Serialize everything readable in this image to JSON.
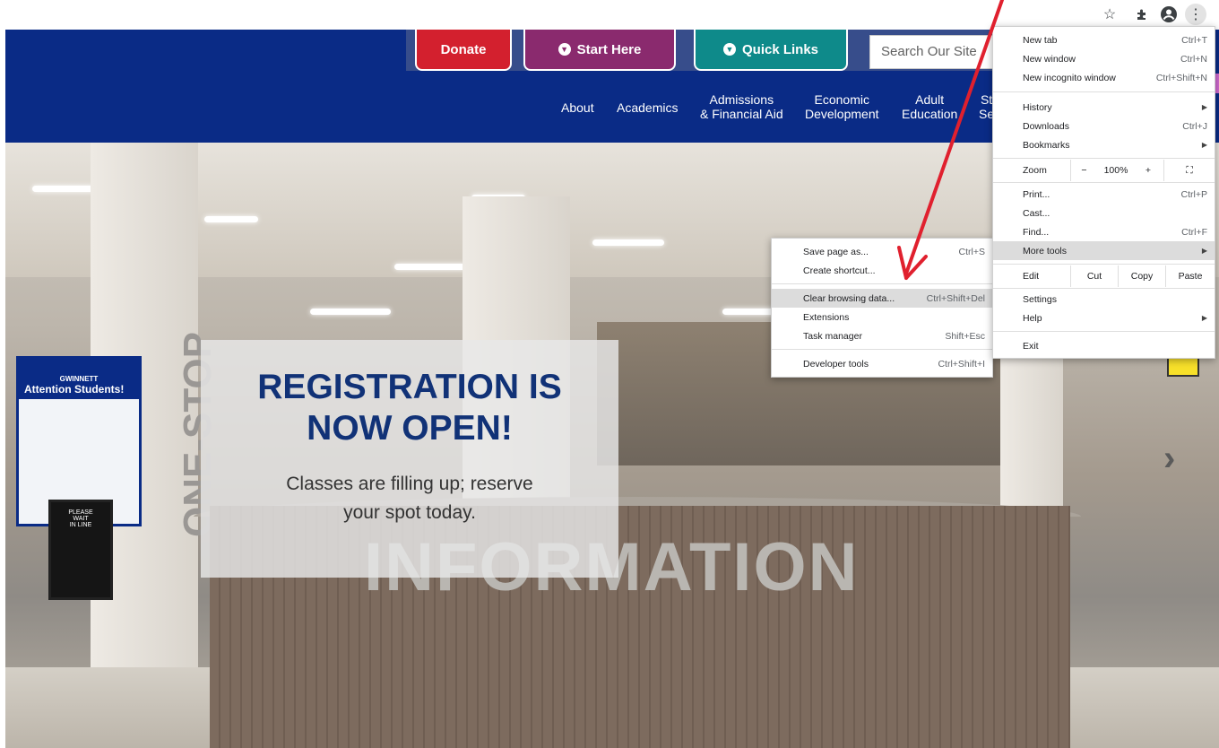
{
  "browser": {
    "menu_icon": "⋮"
  },
  "site": {
    "buttons": {
      "donate": "Donate",
      "start_here": "Start Here",
      "quick_links": "Quick Links"
    },
    "search": {
      "placeholder": "Search Our Site"
    },
    "nav": [
      {
        "line1": "About",
        "line2": ""
      },
      {
        "line1": "Academics",
        "line2": ""
      },
      {
        "line1": "Admissions",
        "line2": "& Financial Aid"
      },
      {
        "line1": "Economic",
        "line2": "Development"
      },
      {
        "line1": "Adult",
        "line2": "Education"
      },
      {
        "line1": "St",
        "line2": "Se"
      }
    ],
    "colors": {
      "header": "#0a2b86",
      "donate": "#d3202e",
      "start_here": "#8a2a6e",
      "quick_links": "#0e8a8a"
    }
  },
  "hero": {
    "title_line1": "REGISTRATION IS",
    "title_line2": "NOW OPEN!",
    "subtitle_line1": "Classes are filling up; reserve",
    "subtitle_line2": "your spot today.",
    "scene": {
      "information": "INFORMATION",
      "one_stop": "ONE-STOP",
      "sign_brand": "GWINNETT",
      "sign_heading": "Attention Students!",
      "wait_line1": "PLEASE",
      "wait_line2": "WAIT",
      "wait_line3": "IN LINE"
    }
  },
  "chrome_menu": {
    "items": {
      "new_tab": {
        "label": "New tab",
        "shortcut": "Ctrl+T"
      },
      "new_window": {
        "label": "New window",
        "shortcut": "Ctrl+N"
      },
      "new_incognito": {
        "label": "New incognito window",
        "shortcut": "Ctrl+Shift+N"
      },
      "history": {
        "label": "History"
      },
      "downloads": {
        "label": "Downloads",
        "shortcut": "Ctrl+J"
      },
      "bookmarks": {
        "label": "Bookmarks"
      },
      "print": {
        "label": "Print...",
        "shortcut": "Ctrl+P"
      },
      "cast": {
        "label": "Cast..."
      },
      "find": {
        "label": "Find...",
        "shortcut": "Ctrl+F"
      },
      "more_tools": {
        "label": "More tools"
      },
      "settings": {
        "label": "Settings"
      },
      "help": {
        "label": "Help"
      },
      "exit": {
        "label": "Exit"
      }
    },
    "zoom": {
      "label": "Zoom",
      "minus": "−",
      "value": "100%",
      "plus": "+",
      "fullscreen": "⛶"
    },
    "edit": {
      "label": "Edit",
      "cut": "Cut",
      "copy": "Copy",
      "paste": "Paste"
    }
  },
  "more_tools_menu": {
    "save_page": {
      "label": "Save page as...",
      "shortcut": "Ctrl+S"
    },
    "create_shortcut": {
      "label": "Create shortcut..."
    },
    "clear_browsing": {
      "label": "Clear browsing data...",
      "shortcut": "Ctrl+Shift+Del"
    },
    "extensions": {
      "label": "Extensions"
    },
    "task_manager": {
      "label": "Task manager",
      "shortcut": "Shift+Esc"
    },
    "developer_tools": {
      "label": "Developer tools",
      "shortcut": "Ctrl+Shift+I"
    }
  },
  "annotation": {
    "color": "#e0202e"
  }
}
